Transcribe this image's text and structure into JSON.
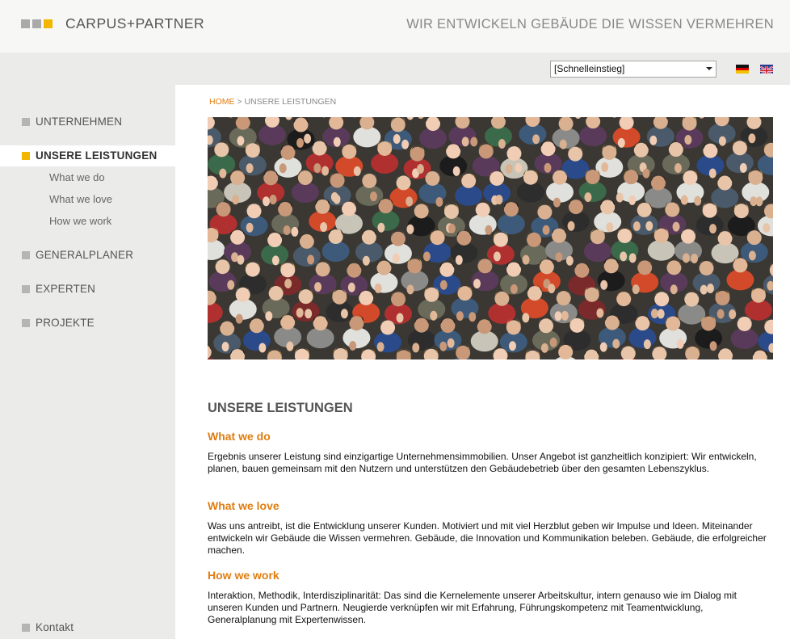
{
  "brand": {
    "name": "CARPUS+PARTNER",
    "tagline": "WIR ENTWICKELN GEBÄUDE DIE WISSEN VERMEHREN",
    "colors": {
      "accent": "#f2b600",
      "link": "#e07d10",
      "logo_grey": "#aaaaaa"
    }
  },
  "topbar": {
    "quick_select": "[Schnelleinstieg]",
    "languages": [
      {
        "icon": "german-flag-icon"
      },
      {
        "icon": "uk-flag-icon"
      }
    ]
  },
  "nav": {
    "items": [
      {
        "label": "UNTERNEHMEN"
      },
      {
        "label": "UNSERE LEISTUNGEN",
        "active": true
      },
      {
        "label": "GENERALPLANER"
      },
      {
        "label": "EXPERTEN"
      },
      {
        "label": "PROJEKTE"
      }
    ],
    "subitems": [
      {
        "label": "What we do"
      },
      {
        "label": "What we love"
      },
      {
        "label": "How we work"
      }
    ],
    "footer": {
      "label": "Kontakt"
    }
  },
  "breadcrumb": {
    "home": "HOME",
    "separator": " > ",
    "current": "UNSERE LEISTUNGEN"
  },
  "main": {
    "title": "UNSERE LEISTUNGEN",
    "sections": [
      {
        "heading": "What we do",
        "text": "Ergebnis unserer Leistung sind einzigartige Unternehmensimmobilien. Unser Angebot ist ganzheitlich konzipiert: Wir entwickeln, planen, bauen gemeinsam mit den Nutzern und unterstützen den Gebäudebetrieb über den gesamten Lebenszyklus."
      },
      {
        "heading": "What we love",
        "text": "Was uns antreibt, ist die Entwicklung unserer Kunden. Motiviert und mit viel Herzblut geben wir Impulse und Ideen. Miteinander entwickeln wir Gebäude die Wissen vermehren. Gebäude, die Innovation und Kommunikation beleben. Gebäude, die erfolgreicher machen."
      },
      {
        "heading": "How we work",
        "text": "Interaktion, Methodik, Interdisziplinarität: Das sind die Kernelemente unserer Arbeitskultur, intern genauso wie im Dialog mit unseren Kunden und Partnern. Neugierde verknüpfen wir mit Erfahrung, Führungskompetenz mit Teamentwicklung, Generalplanung mit Expertenwissen."
      }
    ]
  }
}
